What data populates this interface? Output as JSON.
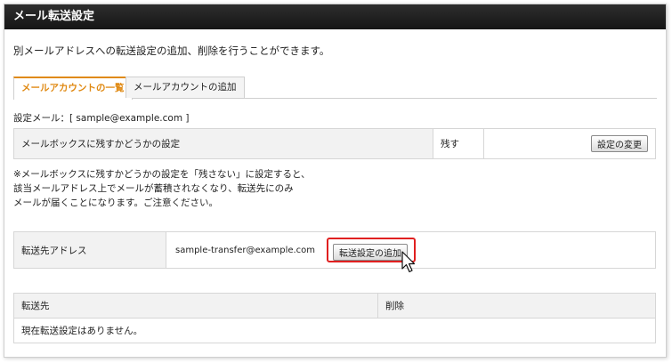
{
  "header": {
    "title": "メール転送設定"
  },
  "description": "別メールアドレスへの転送設定の追加、削除を行うことができます。",
  "tabs": [
    {
      "label": "メールアカウントの一覧",
      "active": true
    },
    {
      "label": "メールアカウントの追加",
      "active": false
    }
  ],
  "setting_mail": "設定メール：[ sample@example.com ]",
  "mailbox_setting": {
    "label": "メールボックスに残すかどうかの設定",
    "value": "残す",
    "button": "設定の変更"
  },
  "note_lines": [
    "※メールボックスに残すかどうかの設定を「残さない」に設定すると、",
    "該当メールアドレス上でメールが蓄積されなくなり、転送先にのみ",
    "メールが届くことになります。ご注意ください。"
  ],
  "forward_form": {
    "label": "転送先アドレス",
    "value": "sample-transfer@example.com",
    "button": "転送設定の追加"
  },
  "forward_table": {
    "columns": [
      "転送先",
      "削除"
    ],
    "empty_message": "現在転送設定はありません。"
  },
  "colors": {
    "accent": "#e08a14",
    "highlight": "#e02020",
    "titlebar": "#1e1e1e"
  }
}
